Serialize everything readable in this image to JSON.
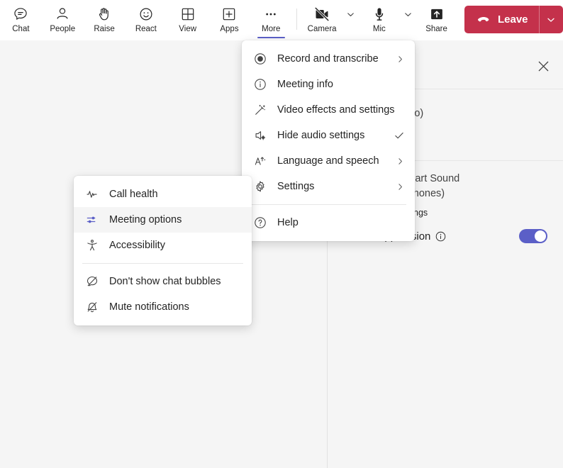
{
  "toolbar": {
    "items": [
      {
        "label": "Chat",
        "icon": "chat-icon"
      },
      {
        "label": "People",
        "icon": "people-icon"
      },
      {
        "label": "Raise",
        "icon": "raise-hand-icon"
      },
      {
        "label": "React",
        "icon": "react-emoji-icon"
      },
      {
        "label": "View",
        "icon": "view-grid-icon"
      },
      {
        "label": "Apps",
        "icon": "apps-plus-icon"
      },
      {
        "label": "More",
        "icon": "more-ellipsis-icon"
      }
    ],
    "active_item": "More",
    "camera": {
      "label": "Camera",
      "icon": "camera-off-icon"
    },
    "mic": {
      "label": "Mic",
      "icon": "microphone-icon"
    },
    "share": {
      "label": "Share",
      "icon": "share-up-arrow-icon"
    },
    "leave": {
      "label": "Leave",
      "icon": "hang-up-phone-icon"
    },
    "accent_color": "#5b5fc7",
    "leave_color": "#c4314b"
  },
  "more_menu": {
    "items": [
      {
        "label": "Record and transcribe",
        "icon": "record-circle-icon",
        "chevron": true,
        "check": false
      },
      {
        "label": "Meeting info",
        "icon": "info-circle-icon",
        "chevron": false,
        "check": false
      },
      {
        "label": "Video effects and settings",
        "icon": "magic-wand-icon",
        "chevron": false,
        "check": false
      },
      {
        "label": "Hide audio settings",
        "icon": "speaker-gear-icon",
        "chevron": false,
        "check": true
      },
      {
        "label": "Language and speech",
        "icon": "text-language-icon",
        "chevron": true,
        "check": false
      },
      {
        "label": "Settings",
        "icon": "gear-icon",
        "chevron": true,
        "check": false
      }
    ],
    "footer": {
      "label": "Help",
      "icon": "help-question-icon"
    }
  },
  "settings_submenu": {
    "items": [
      {
        "label": "Call health",
        "icon": "pulse-waveform-icon",
        "highlight": false
      },
      {
        "label": "Meeting options",
        "icon": "sliders-options-icon",
        "highlight": true
      },
      {
        "label": "Accessibility",
        "icon": "accessibility-person-icon",
        "highlight": false
      }
    ],
    "items_after_separator": [
      {
        "label": "Don't show chat bubbles",
        "icon": "chat-bubble-off-icon"
      },
      {
        "label": "Mute notifications",
        "icon": "bell-off-icon"
      }
    ]
  },
  "audio_panel": {
    "close_icon": "close-icon",
    "speaker_device": "(Realtek(R) Audio)",
    "speaker_device_alt": "altek(R) Audio)",
    "mic_device_line1": "Array (Intel® Smart Sound",
    "mic_device_line2": "or Digital Microphones)",
    "advanced_settings_label": "Advanced settings",
    "noise_suppression_label": "Noise suppression",
    "noise_suppression_info_icon": "info-circle-icon",
    "noise_suppression_on": true,
    "toggle_color": "#5b5fc7"
  }
}
